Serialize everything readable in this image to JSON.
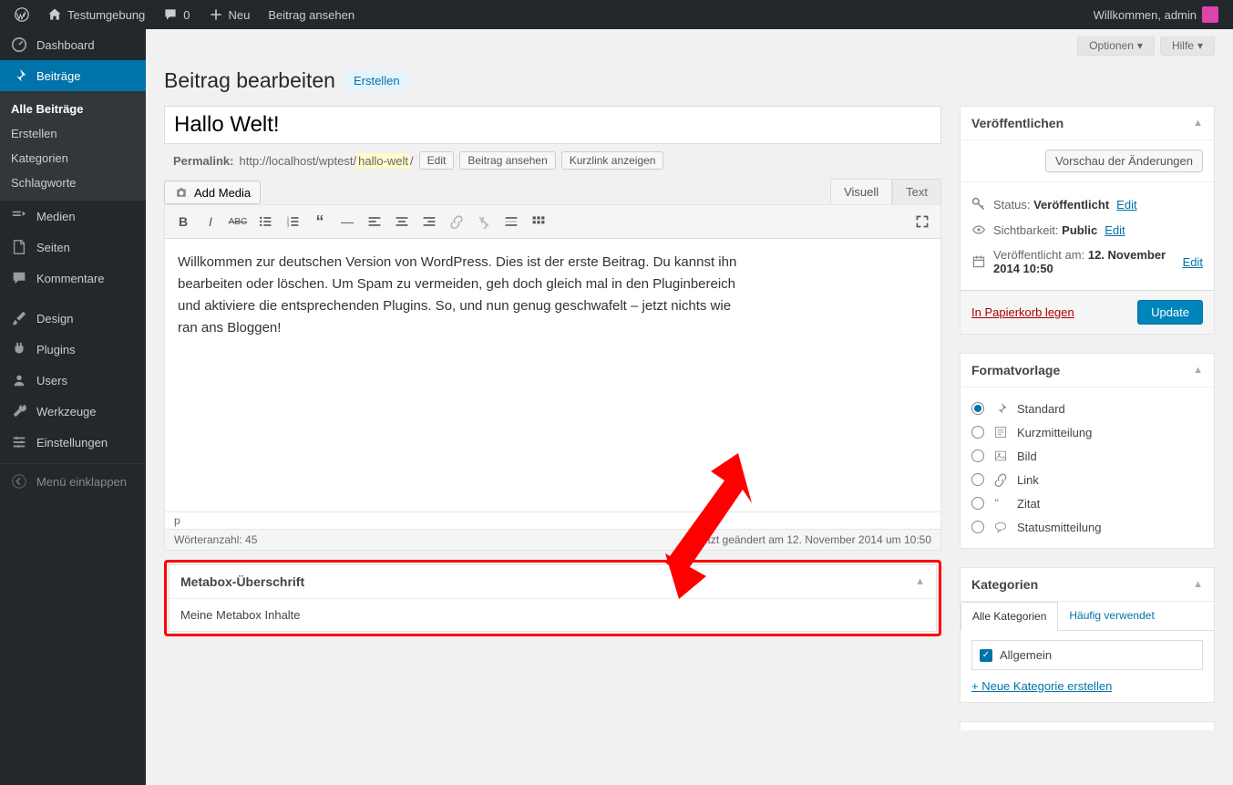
{
  "adminbar": {
    "site_name": "Testumgebung",
    "comments_count": "0",
    "new_label": "Neu",
    "view_post": "Beitrag ansehen",
    "welcome": "Willkommen, admin"
  },
  "sidebar": {
    "items": [
      {
        "label": "Dashboard"
      },
      {
        "label": "Beiträge"
      },
      {
        "label": "Medien"
      },
      {
        "label": "Seiten"
      },
      {
        "label": "Kommentare"
      },
      {
        "label": "Design"
      },
      {
        "label": "Plugins"
      },
      {
        "label": "Users"
      },
      {
        "label": "Werkzeuge"
      },
      {
        "label": "Einstellungen"
      }
    ],
    "submenu": [
      {
        "label": "Alle Beiträge"
      },
      {
        "label": "Erstellen"
      },
      {
        "label": "Kategorien"
      },
      {
        "label": "Schlagworte"
      }
    ],
    "collapse": "Menü einklappen"
  },
  "screen": {
    "options": "Optionen",
    "help": "Hilfe"
  },
  "page": {
    "title": "Beitrag bearbeiten",
    "add_new": "Erstellen"
  },
  "post": {
    "title": "Hallo Welt!",
    "permalink_label": "Permalink:",
    "permalink_base": "http://localhost/wptest/",
    "permalink_slug": "hallo-welt",
    "permalink_trail": "/",
    "edit_btn": "Edit",
    "view_btn": "Beitrag ansehen",
    "shortlink_btn": "Kurzlink anzeigen",
    "add_media": "Add Media",
    "tab_visual": "Visuell",
    "tab_text": "Text",
    "content": "Willkommen zur deutschen Version von WordPress. Dies ist der erste Beitrag. Du kannst ihn bearbeiten oder löschen. Um Spam zu vermeiden, geh doch gleich mal in den Pluginbereich und aktiviere die entsprechenden Plugins. So, und nun genug geschwafelt – jetzt nichts wie ran ans Bloggen!",
    "path": "p",
    "wordcount": "Wörteranzahl: 45",
    "lastedit": "Zuletzt geändert am 12. November 2014 um 10:50"
  },
  "metabox": {
    "title": "Metabox-Überschrift",
    "content": "Meine Metabox Inhalte"
  },
  "publish": {
    "title": "Veröffentlichen",
    "preview_btn": "Vorschau der Änderungen",
    "status_label": "Status:",
    "status_value": "Veröffentlicht",
    "visibility_label": "Sichtbarkeit:",
    "visibility_value": "Public",
    "published_label": "Veröffentlicht am:",
    "published_value": "12. November 2014 10:50",
    "edit_link": "Edit",
    "trash": "In Papierkorb legen",
    "update_btn": "Update"
  },
  "format": {
    "title": "Formatvorlage",
    "options": [
      "Standard",
      "Kurzmitteilung",
      "Bild",
      "Link",
      "Zitat",
      "Statusmitteilung"
    ]
  },
  "categories": {
    "title": "Kategorien",
    "tab_all": "Alle Kategorien",
    "tab_popular": "Häufig verwendet",
    "item": "Allgemein",
    "add_new": "+ Neue Kategorie erstellen"
  }
}
